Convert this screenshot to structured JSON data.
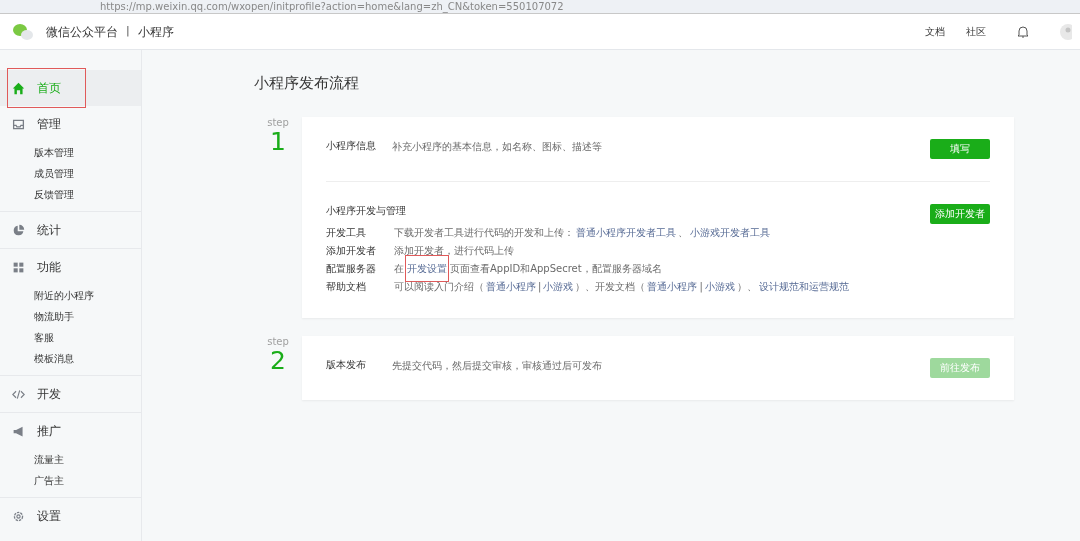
{
  "browser": {
    "url": "https://mp.weixin.qq.com/wxopen/initprofile?action=home&lang=zh_CN&token=550107072"
  },
  "header": {
    "brand": "微信公众平台",
    "divider": "|",
    "product": "小程序",
    "links": [
      "文档",
      "社区"
    ]
  },
  "sidebar": {
    "groups": [
      {
        "label": "首页",
        "selected": true,
        "annotated": true
      },
      {
        "label": "管理",
        "selected": false,
        "annotated": false,
        "children": [
          "版本管理",
          "成员管理",
          "反馈管理"
        ]
      },
      {
        "label": "统计",
        "selected": false,
        "annotated": false
      },
      {
        "label": "功能",
        "selected": false,
        "annotated": false,
        "children": [
          "附近的小程序",
          "物流助手",
          "客服",
          "模板消息"
        ]
      },
      {
        "label": "开发",
        "selected": false,
        "annotated": false
      },
      {
        "label": "推广",
        "selected": false,
        "annotated": false,
        "children": [
          "流量主",
          "广告主"
        ]
      },
      {
        "label": "设置",
        "selected": false,
        "annotated": false
      }
    ]
  },
  "page": {
    "title": "小程序发布流程",
    "steps": [
      {
        "step_label": "step",
        "number": "1",
        "sections": [
          {
            "title": "小程序信息",
            "description": "补充小程序的基本信息，如名称、图标、描述等",
            "button": {
              "label": "填写",
              "disabled": false
            }
          },
          {
            "title": "小程序开发与管理",
            "button": {
              "label": "添加开发者",
              "disabled": false
            },
            "rows": [
              {
                "label": "开发工具",
                "segments": [
                  {
                    "kind": "text",
                    "text": "下载开发者工具进行代码的开发和上传："
                  },
                  {
                    "kind": "link",
                    "text": "普通小程序开发者工具",
                    "annotated": false
                  },
                  {
                    "kind": "text",
                    "text": "、"
                  },
                  {
                    "kind": "link",
                    "text": "小游戏开发者工具",
                    "annotated": false
                  }
                ]
              },
              {
                "label": "添加开发者",
                "segments": [
                  {
                    "kind": "text",
                    "text": "添加开发者，进行代码上传"
                  }
                ]
              },
              {
                "label": "配置服务器",
                "segments": [
                  {
                    "kind": "text",
                    "text": "在"
                  },
                  {
                    "kind": "link",
                    "text": "开发设置",
                    "annotated": true
                  },
                  {
                    "kind": "text",
                    "text": "页面查看AppID和AppSecret，配置服务器域名"
                  }
                ]
              },
              {
                "label": "帮助文档",
                "segments": [
                  {
                    "kind": "text",
                    "text": "可以阅读入门介绍（"
                  },
                  {
                    "kind": "link",
                    "text": "普通小程序",
                    "annotated": false
                  },
                  {
                    "kind": "text",
                    "text": "|"
                  },
                  {
                    "kind": "link",
                    "text": "小游戏",
                    "annotated": false
                  },
                  {
                    "kind": "text",
                    "text": "）、开发文档（"
                  },
                  {
                    "kind": "link",
                    "text": "普通小程序",
                    "annotated": false
                  },
                  {
                    "kind": "text",
                    "text": "|"
                  },
                  {
                    "kind": "link",
                    "text": "小游戏",
                    "annotated": false
                  },
                  {
                    "kind": "text",
                    "text": "）、"
                  },
                  {
                    "kind": "link",
                    "text": "设计规范和运营规范",
                    "annotated": false
                  }
                ]
              }
            ]
          }
        ]
      },
      {
        "step_label": "step",
        "number": "2",
        "sections": [
          {
            "title": "版本发布",
            "description": "先提交代码，然后提交审核，审核通过后可发布",
            "button": {
              "label": "前往发布",
              "disabled": true
            }
          }
        ]
      }
    ]
  }
}
